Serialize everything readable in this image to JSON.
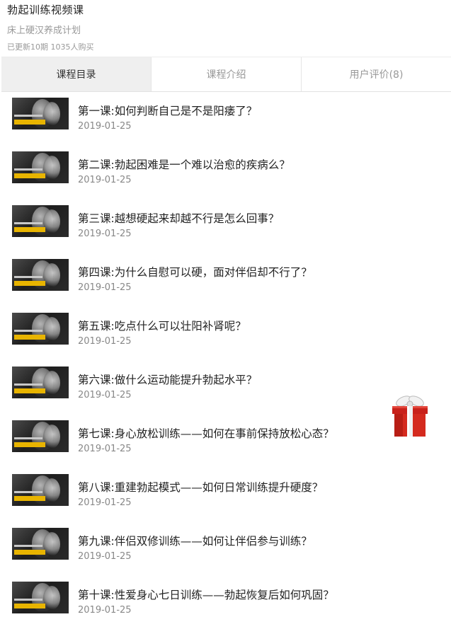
{
  "course": {
    "title": "勃起训练视频课",
    "subtitle": "床上硬汉养成计划",
    "stats": "已更新10期 1035人购买"
  },
  "tabs": [
    {
      "label": "课程目录",
      "active": true
    },
    {
      "label": "课程介绍",
      "active": false
    },
    {
      "label": "用户评价(8)",
      "active": false
    }
  ],
  "lessons": [
    {
      "title": "第一课:如何判断自己是不是阳痿了？",
      "date": "2019-01-25"
    },
    {
      "title": "第二课:勃起困难是一个难以治愈的疾病么？",
      "date": "2019-01-25"
    },
    {
      "title": "第三课:越想硬起来却越不行是怎么回事？",
      "date": "2019-01-25"
    },
    {
      "title": "第四课:为什么自慰可以硬，面对伴侣却不行了？",
      "date": "2019-01-25"
    },
    {
      "title": "第五课:吃点什么可以壮阳补肾呢？",
      "date": "2019-01-25"
    },
    {
      "title": "第六课:做什么运动能提升勃起水平？",
      "date": "2019-01-25"
    },
    {
      "title": "第七课:身心放松训练——如何在事前保持放松心态？",
      "date": "2019-01-25"
    },
    {
      "title": "第八课:重建勃起模式——如何日常训练提升硬度？",
      "date": "2019-01-25"
    },
    {
      "title": "第九课:伴侣双修训练——如何让伴侣参与训练？",
      "date": "2019-01-25"
    },
    {
      "title": "第十课:性爱身心七日训练——勃起恢复后如何巩固？",
      "date": "2019-01-25"
    }
  ],
  "icons": {
    "gift": "gift-icon"
  },
  "colors": {
    "active_tab_bg": "#efefef",
    "gift_red": "#d42a1e"
  }
}
